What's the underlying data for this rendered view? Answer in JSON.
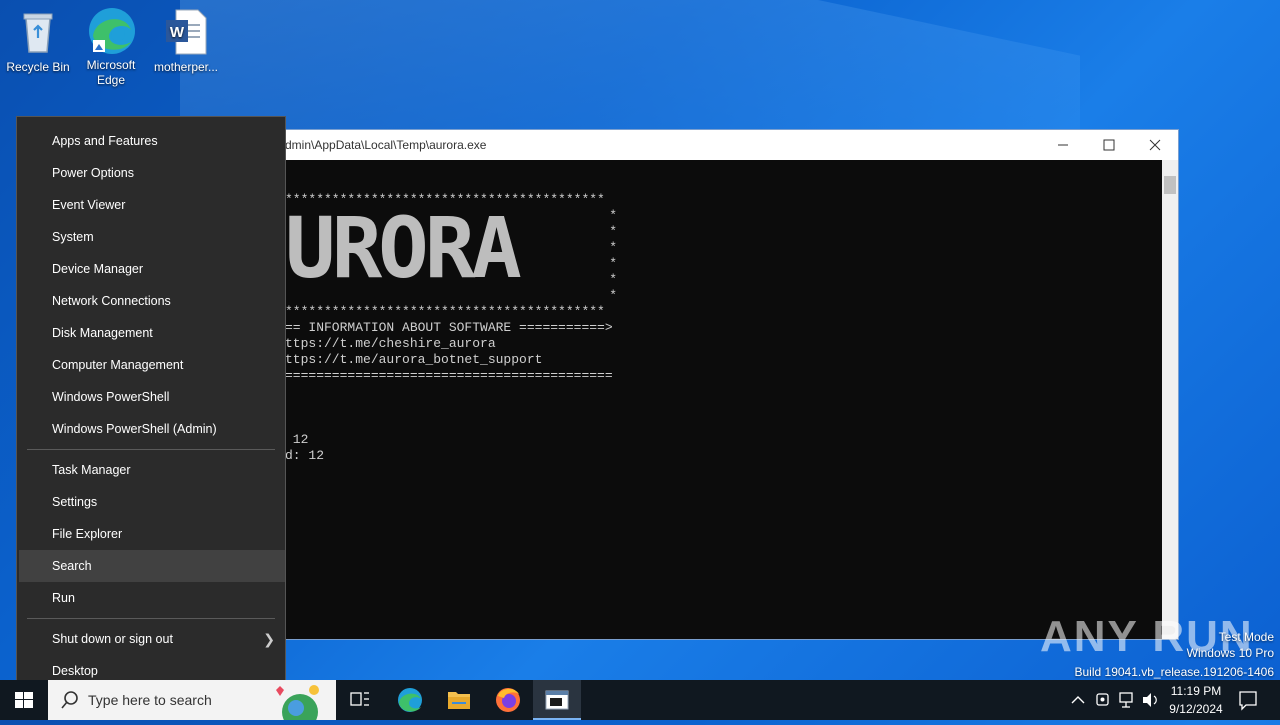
{
  "desktop": {
    "icons": [
      {
        "label": "Recycle Bin"
      },
      {
        "label": "Microsoft Edge"
      },
      {
        "label": "motherper..."
      }
    ]
  },
  "console": {
    "title": "dmin\\AppData\\Local\\Temp\\aurora.exe",
    "lines": [
      "*****************************************",
      "== INFORMATION ABOUT SOFTWARE ===========>",
      "ttps://t.me/cheshire_aurora",
      "ttps://t.me/aurora_botnet_support",
      "==========================================",
      " 12",
      "d: 12"
    ],
    "banner": "URORA"
  },
  "menu": {
    "items": [
      "Apps and Features",
      "Power Options",
      "Event Viewer",
      "System",
      "Device Manager",
      "Network Connections",
      "Disk Management",
      "Computer Management",
      "Windows PowerShell",
      "Windows PowerShell (Admin)",
      "Task Manager",
      "Settings",
      "File Explorer",
      "Search",
      "Run",
      "Shut down or sign out",
      "Desktop"
    ]
  },
  "taskbar": {
    "search_placeholder": "Type here to search",
    "time": "11:19 PM",
    "date": "9/12/2024"
  },
  "watermark": {
    "line1": "Test Mode",
    "line2": "Windows 10 Pro",
    "line3": "Build 19041.vb_release.191206-1406",
    "brand": "ANY RUN"
  },
  "colors": {
    "accent": "#0078d7",
    "menu_bg": "#2b2b2b",
    "taskbar_bg": "#101820"
  }
}
